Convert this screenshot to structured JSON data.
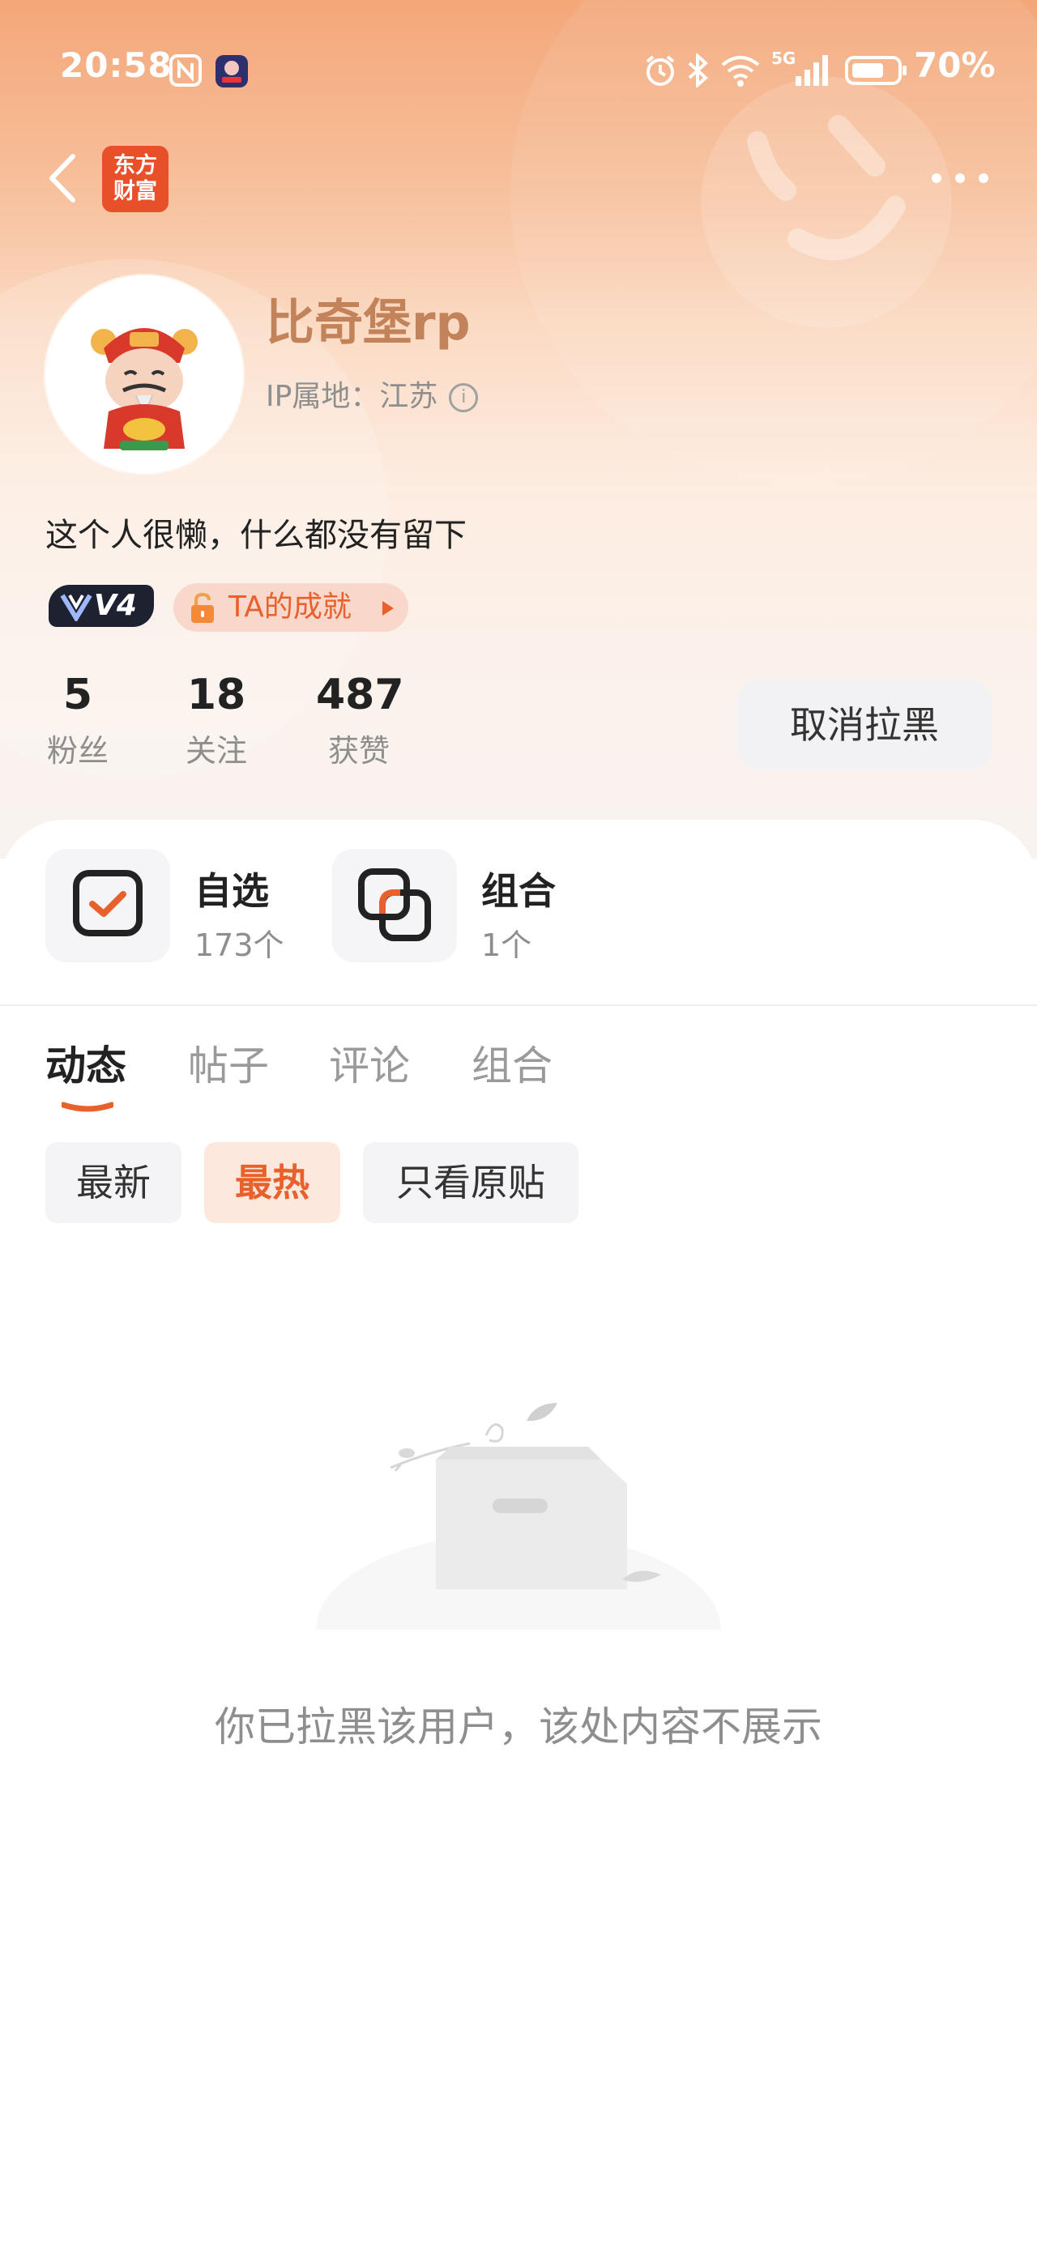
{
  "status_bar": {
    "time": "20:58",
    "battery": "70%",
    "network": "5G",
    "icons": [
      "nfc-icon",
      "app-notification-icon",
      "alarm-icon",
      "bluetooth-icon",
      "wifi-icon",
      "signal-icon",
      "battery-icon"
    ]
  },
  "header": {
    "logo_line1": "东方",
    "logo_line2": "财富",
    "back_icon": "chevron-left-icon",
    "more_icon": "more-dots-icon"
  },
  "profile": {
    "username": "比奇堡rp",
    "ip_location": "IP属地：江苏",
    "bio": "这个人很懒，什么都没有留下",
    "level_badge": "V4",
    "achievement_label": "TA的成就"
  },
  "stats": [
    {
      "value": "5",
      "label": "粉丝"
    },
    {
      "value": "18",
      "label": "关注"
    },
    {
      "value": "487",
      "label": "获赞"
    }
  ],
  "unblock_button": "取消拉黑",
  "portfolio": [
    {
      "title": "自选",
      "count": "173个",
      "icon": "watchlist-check-icon"
    },
    {
      "title": "组合",
      "count": "1个",
      "icon": "portfolio-stack-icon"
    }
  ],
  "tabs": [
    {
      "label": "动态",
      "active": true
    },
    {
      "label": "帖子",
      "active": false
    },
    {
      "label": "评论",
      "active": false
    },
    {
      "label": "组合",
      "active": false
    }
  ],
  "filters": [
    {
      "label": "最新",
      "active": false
    },
    {
      "label": "最热",
      "active": true
    },
    {
      "label": "只看原贴",
      "active": false
    }
  ],
  "empty_state": {
    "message": "你已拉黑该用户，该处内容不展示",
    "icon": "empty-box-icon"
  },
  "colors": {
    "accent": "#e8602c",
    "username": "#c2825a",
    "hero_top": "#f4a779"
  }
}
